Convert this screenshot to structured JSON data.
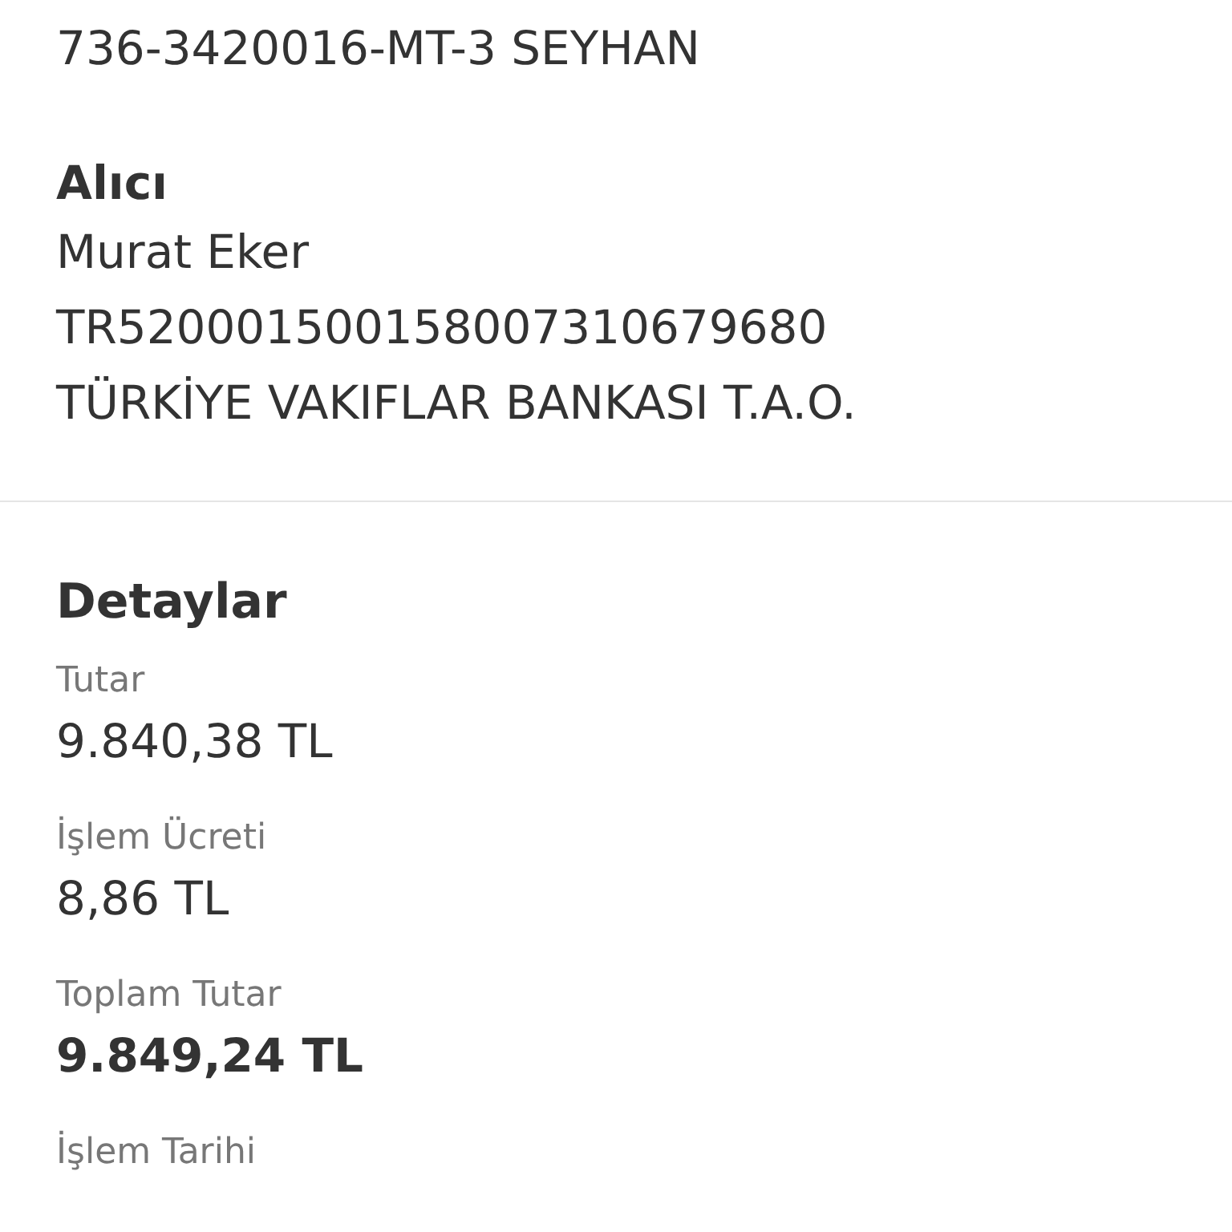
{
  "sender_branch": "736-3420016-MT-3 SEYHAN",
  "recipient": {
    "heading": "Alıcı",
    "lines": [
      "Murat Eker",
      "TR520001500158007310679680",
      "TÜRKİYE VAKIFLAR BANKASI T.A.O."
    ]
  },
  "details": {
    "heading": "Detaylar",
    "fields": [
      {
        "label": "Tutar",
        "value": "9.840,38 TL",
        "kind": "plain"
      },
      {
        "label": "İşlem Ücreti",
        "value": "8,86 TL",
        "kind": "plain"
      },
      {
        "label": "Toplam Tutar",
        "value": "9.849,24 TL",
        "kind": "total"
      },
      {
        "label": "İşlem Tarihi"
      }
    ]
  }
}
